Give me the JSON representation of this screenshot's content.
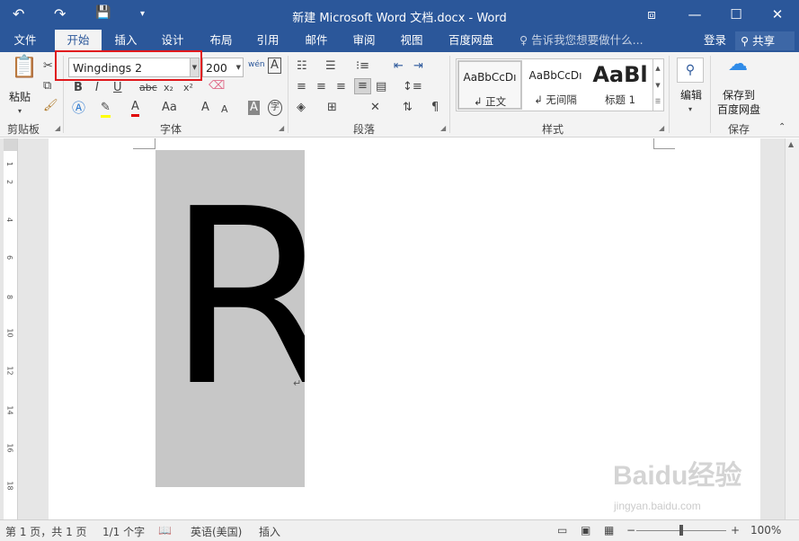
{
  "titlebar": {
    "title": "新建 Microsoft Word 文档.docx - Word",
    "undo_icon": "↶",
    "redo_icon": "↷",
    "save_icon": "💾",
    "customize_icon": "▾",
    "ribbon_opts_icon": "⧈",
    "minimize_icon": "—",
    "maximize_icon": "☐",
    "close_icon": "✕"
  },
  "tabs": {
    "file": "文件",
    "home": "开始",
    "insert": "插入",
    "design": "设计",
    "layout": "布局",
    "references": "引用",
    "mailings": "邮件",
    "review": "审阅",
    "view": "视图",
    "baidu": "百度网盘",
    "tell_me": "告诉我您想要做什么...",
    "login": "登录",
    "share": "共享"
  },
  "ribbon": {
    "clipboard": {
      "paste": "粘贴",
      "label": "剪贴板"
    },
    "font": {
      "name": "Wingdings 2",
      "size": "200",
      "label": "字体",
      "bold": "B",
      "italic": "I",
      "underline": "U",
      "strike": "abc",
      "subscript": "x₂",
      "superscript": "x²",
      "grow": "A",
      "shrink": "A",
      "char_shade": "A",
      "enclose": "字",
      "pinyin": "wén",
      "border": "A"
    },
    "paragraph": {
      "label": "段落"
    },
    "styles": {
      "label": "样式",
      "items": [
        {
          "preview": "AaBbCcDı",
          "name": "↲ 正文"
        },
        {
          "preview": "AaBbCcDı",
          "name": "↲ 无间隔"
        },
        {
          "preview": "AaBl",
          "name": "标题 1"
        }
      ]
    },
    "editing": {
      "label": "编辑"
    },
    "save": {
      "label_line1": "保存到",
      "label_line2": "百度网盘",
      "group_label": "保存"
    }
  },
  "document": {
    "content": "R",
    "paragraph_mark": "↵"
  },
  "ruler": [
    "1",
    "2",
    "4",
    "6",
    "8",
    "10",
    "12",
    "14",
    "16",
    "18"
  ],
  "statusbar": {
    "page": "第 1 页，共 1 页",
    "words": "1/1 个字",
    "lang": "英语(美国)",
    "mode": "插入",
    "zoom_out": "−",
    "zoom_in": "+",
    "zoom": "100%"
  },
  "watermark": {
    "main": "Baidu经验",
    "sub": "jingyan.baidu.com"
  }
}
